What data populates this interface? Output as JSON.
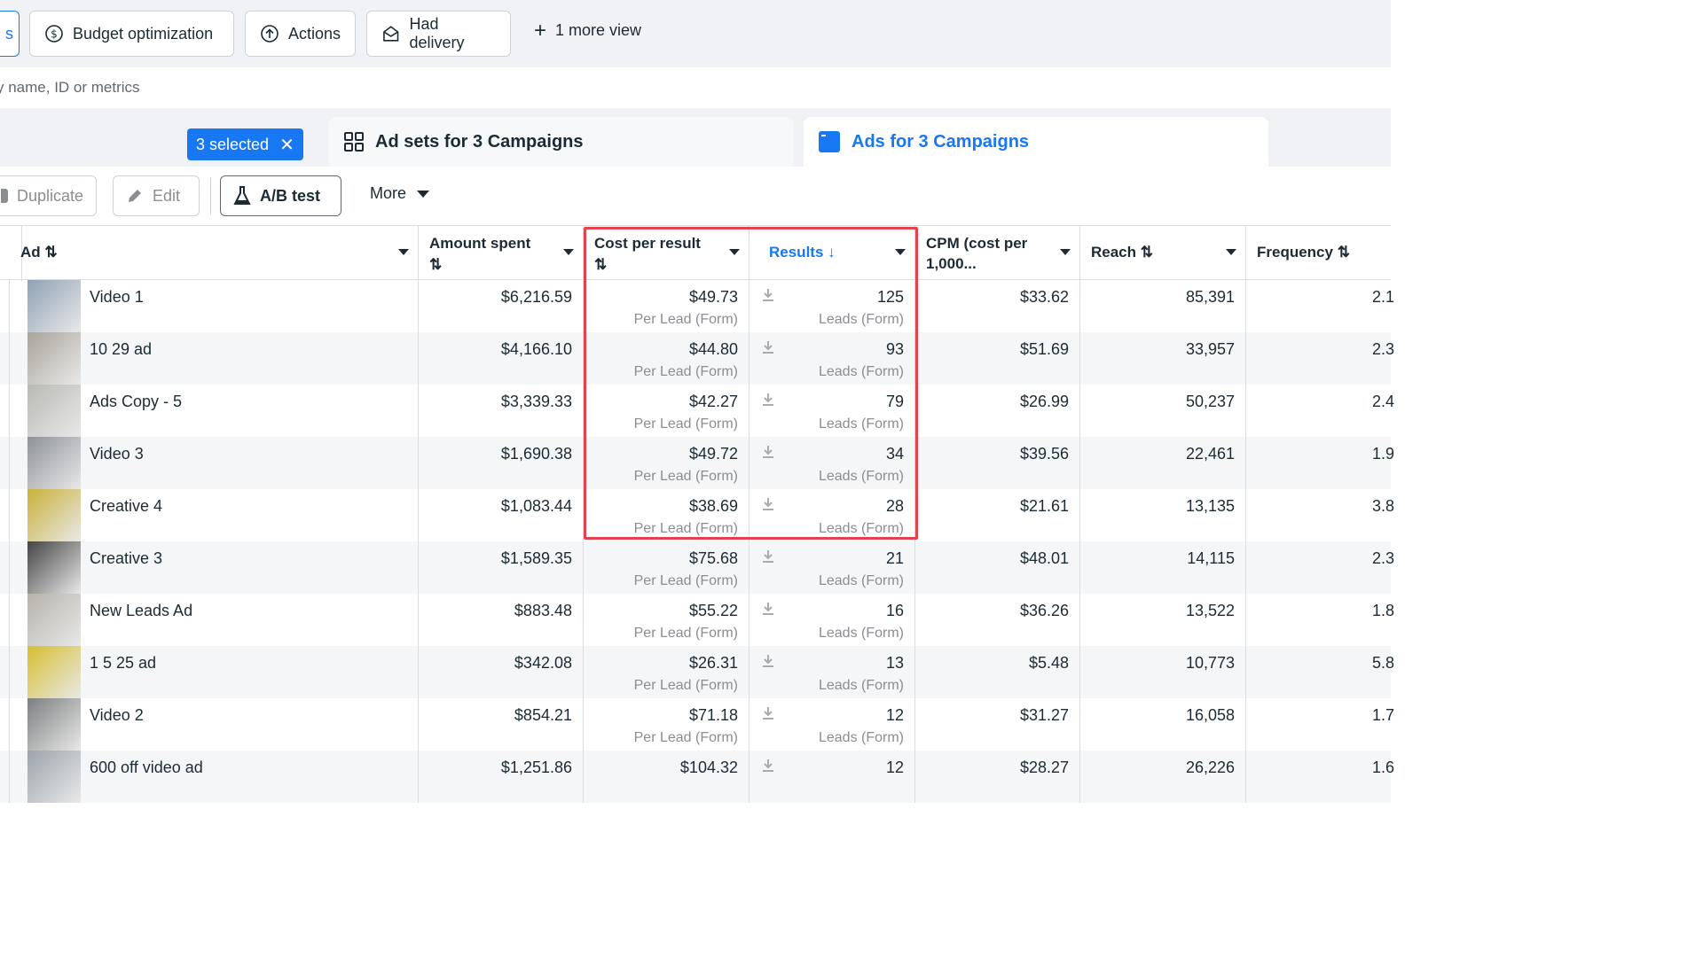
{
  "viewbar": {
    "left_chip_text": "s",
    "chips": [
      {
        "label": "Budget optimization",
        "icon": "dollar-circle-icon"
      },
      {
        "label": "Actions",
        "icon": "arrow-up-circle-icon"
      },
      {
        "label": "Had delivery",
        "icon": "envelope-open-icon"
      }
    ],
    "more_views": "1 more view"
  },
  "search": {
    "placeholder_visible": "y name, ID or metrics"
  },
  "tabs": {
    "selected_badge": "3 selected",
    "adsets": "Ad sets for 3 Campaigns",
    "ads": "Ads for 3 Campaigns"
  },
  "toolbar": {
    "duplicate": "Duplicate",
    "edit": "Edit",
    "ab_test": "A/B test",
    "more": "More"
  },
  "columns": {
    "ad": "Ad ⇅",
    "amount_spent": "Amount spent",
    "amount_spent_sort": "⇅",
    "cost_per_result": "Cost per result",
    "cost_per_result_sort": "⇅",
    "results": "Results ↓",
    "cpm_line1": "CPM (cost per",
    "cpm_line2": "1,000...",
    "reach": "Reach ⇅",
    "frequency": "Frequency ⇅"
  },
  "rows": [
    {
      "name": "Video 1",
      "spent": "$6,216.59",
      "cpr": "$49.73",
      "cpr_sub": "Per Lead (Form)",
      "results": "125",
      "results_sub": "Leads (Form)",
      "cpm": "$33.62",
      "reach": "85,391",
      "freq": "2.1"
    },
    {
      "name": "10 29 ad",
      "spent": "$4,166.10",
      "cpr": "$44.80",
      "cpr_sub": "Per Lead (Form)",
      "results": "93",
      "results_sub": "Leads (Form)",
      "cpm": "$51.69",
      "reach": "33,957",
      "freq": "2.3"
    },
    {
      "name": "Ads Copy - 5",
      "spent": "$3,339.33",
      "cpr": "$42.27",
      "cpr_sub": "Per Lead (Form)",
      "results": "79",
      "results_sub": "Leads (Form)",
      "cpm": "$26.99",
      "reach": "50,237",
      "freq": "2.4"
    },
    {
      "name": "Video 3",
      "spent": "$1,690.38",
      "cpr": "$49.72",
      "cpr_sub": "Per Lead (Form)",
      "results": "34",
      "results_sub": "Leads (Form)",
      "cpm": "$39.56",
      "reach": "22,461",
      "freq": "1.9"
    },
    {
      "name": "Creative 4",
      "spent": "$1,083.44",
      "cpr": "$38.69",
      "cpr_sub": "Per Lead (Form)",
      "results": "28",
      "results_sub": "Leads (Form)",
      "cpm": "$21.61",
      "reach": "13,135",
      "freq": "3.8"
    },
    {
      "name": "Creative 3",
      "spent": "$1,589.35",
      "cpr": "$75.68",
      "cpr_sub": "Per Lead (Form)",
      "results": "21",
      "results_sub": "Leads (Form)",
      "cpm": "$48.01",
      "reach": "14,115",
      "freq": "2.3"
    },
    {
      "name": "New Leads Ad",
      "spent": "$883.48",
      "cpr": "$55.22",
      "cpr_sub": "Per Lead (Form)",
      "results": "16",
      "results_sub": "Leads (Form)",
      "cpm": "$36.26",
      "reach": "13,522",
      "freq": "1.8"
    },
    {
      "name": "1 5 25 ad",
      "spent": "$342.08",
      "cpr": "$26.31",
      "cpr_sub": "Per Lead (Form)",
      "results": "13",
      "results_sub": "Leads (Form)",
      "cpm": "$5.48",
      "reach": "10,773",
      "freq": "5.8"
    },
    {
      "name": "Video 2",
      "spent": "$854.21",
      "cpr": "$71.18",
      "cpr_sub": "Per Lead (Form)",
      "results": "12",
      "results_sub": "Leads (Form)",
      "cpm": "$31.27",
      "reach": "16,058",
      "freq": "1.7"
    },
    {
      "name": "600 off video ad",
      "spent": "$1,251.86",
      "cpr": "$104.32",
      "cpr_sub": "",
      "results": "12",
      "results_sub": "",
      "cpm": "$28.27",
      "reach": "26,226",
      "freq": "1.6"
    }
  ],
  "colors": {
    "accent": "#1877f2",
    "highlight": "#e4424d",
    "border": "#dadde1"
  }
}
